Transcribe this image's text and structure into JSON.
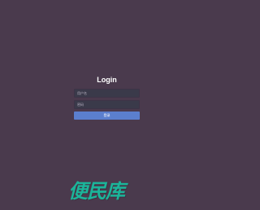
{
  "login": {
    "title": "Login",
    "username_placeholder": "用户名",
    "password_placeholder": "密码",
    "submit_label": "登录"
  },
  "footer": {
    "text": "",
    "link": ""
  },
  "watermark": {
    "text": "便民库"
  },
  "colors": {
    "background": "#4a3a4d",
    "input_bg": "#3a3a4a",
    "button_bg": "#5b7fce",
    "watermark": "#1bb59a"
  }
}
